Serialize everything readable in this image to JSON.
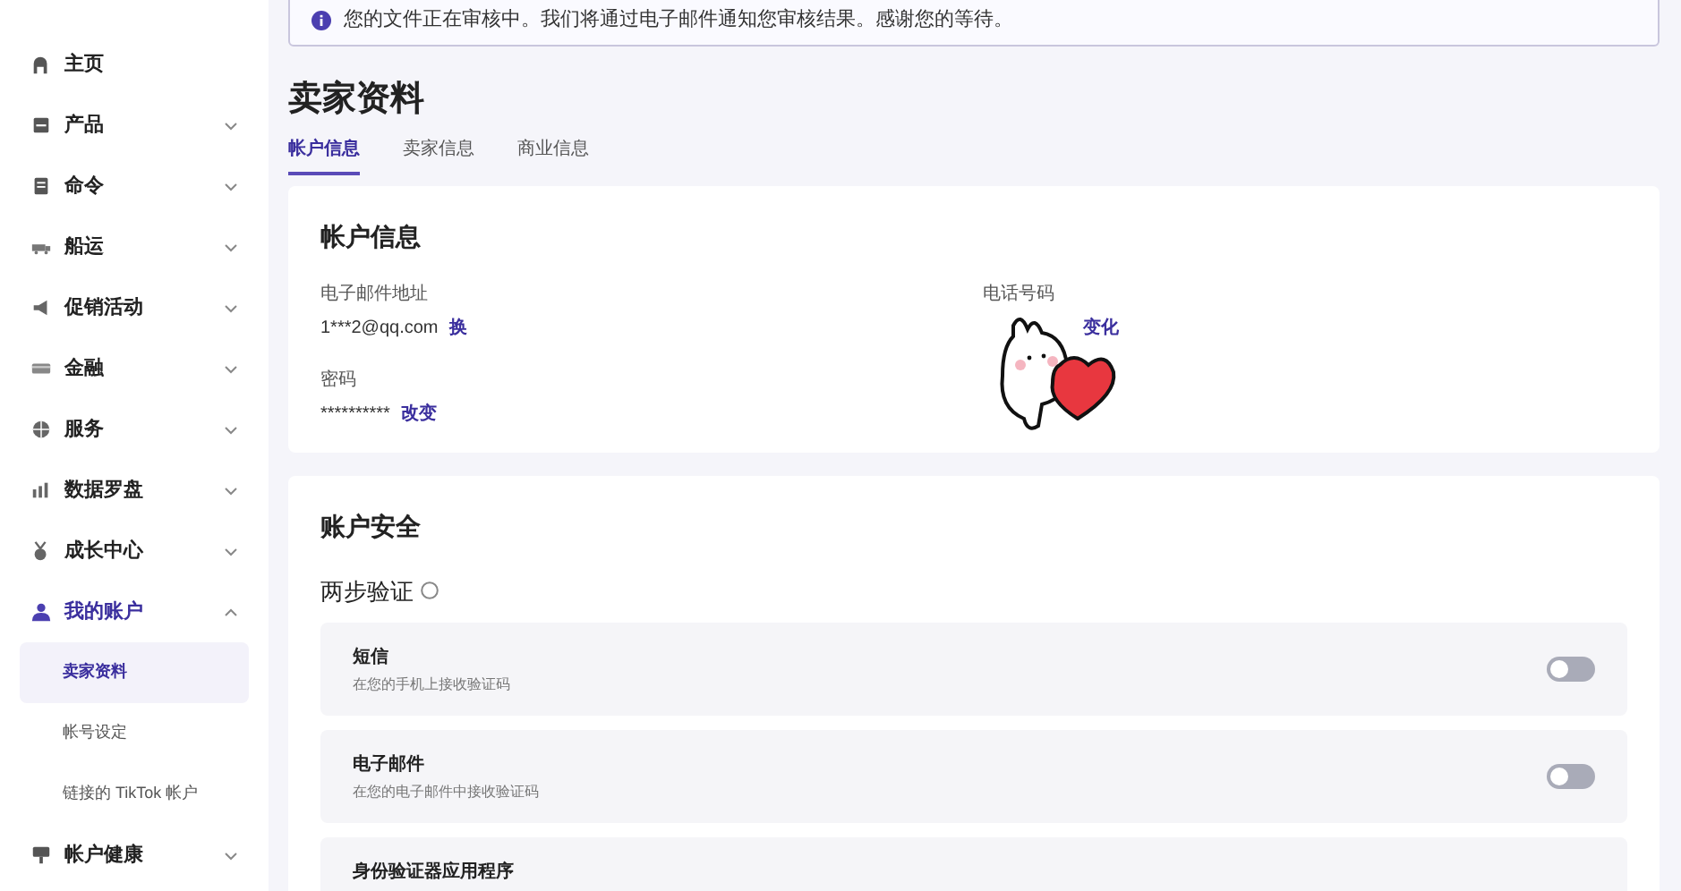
{
  "sidebar": {
    "items": [
      {
        "label": "主页"
      },
      {
        "label": "产品",
        "expanded": false
      },
      {
        "label": "命令",
        "expanded": false
      },
      {
        "label": "船运",
        "expanded": false
      },
      {
        "label": "促销活动",
        "expanded": false
      },
      {
        "label": "金融",
        "expanded": false
      },
      {
        "label": "服务",
        "expanded": false
      },
      {
        "label": "数据罗盘",
        "expanded": false
      },
      {
        "label": "成长中心",
        "expanded": false
      },
      {
        "label": "我的账户",
        "expanded": true,
        "children": [
          {
            "label": "卖家资料",
            "selected": true
          },
          {
            "label": "帐号设定",
            "selected": false
          },
          {
            "label": "链接的 TikTok 帐户",
            "selected": false
          }
        ]
      },
      {
        "label": "帐户健康",
        "expanded": false
      }
    ]
  },
  "notice": "您的文件正在审核中。我们将通过电子邮件通知您审核结果。感谢您的等待。",
  "page_title": "卖家资料",
  "tabs": [
    {
      "label": "帐户信息",
      "selected": true
    },
    {
      "label": "卖家信息",
      "selected": false
    },
    {
      "label": "商业信息",
      "selected": false
    }
  ],
  "account_info": {
    "title": "帐户信息",
    "fields": [
      {
        "label": "电子邮件地址",
        "value": "1***2@qq.com",
        "action": "换"
      },
      {
        "label": "电话号码",
        "action": "变化"
      },
      {
        "label": "密码",
        "value": "**********",
        "action": "改变"
      }
    ]
  },
  "security": {
    "title": "账户安全",
    "subtitle": "两步验证",
    "methods": [
      {
        "title": "短信",
        "description": "在您的手机上接收验证码",
        "on": false
      },
      {
        "title": "电子邮件",
        "description": "在您的电子邮件中接收验证码",
        "on": false
      },
      {
        "title": "身份验证器应用程序"
      }
    ]
  }
}
